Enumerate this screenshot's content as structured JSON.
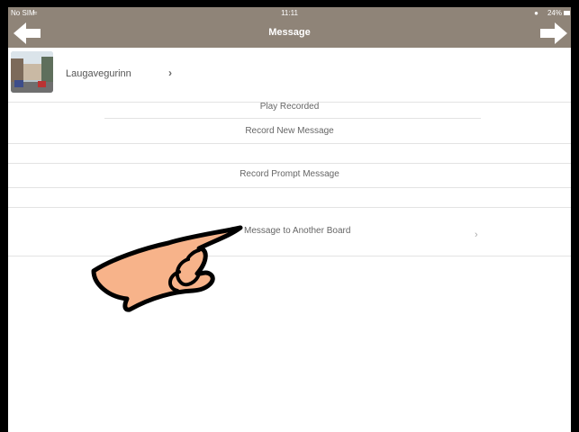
{
  "status_bar": {
    "carrier": "No SIM",
    "time": "11:11",
    "battery": "24%"
  },
  "nav": {
    "title": "Message",
    "back_icon": "left-arrow-icon",
    "forward_icon": "right-arrow-icon"
  },
  "board": {
    "name": "Laugavegurinn"
  },
  "menu": {
    "play_recorded": "Play Recorded",
    "record_new": "Record New Message",
    "record_prompt": "Record Prompt Message",
    "copy_message": "Message to Another Board"
  },
  "colors": {
    "nav_bg": "#8f8478",
    "hand_fill": "#f7b38a"
  }
}
